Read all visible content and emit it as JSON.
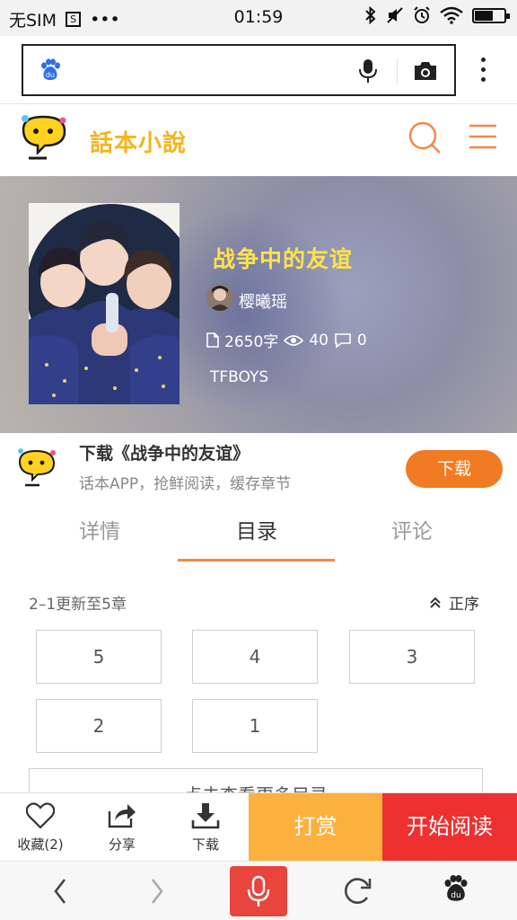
{
  "status_bar": {
    "carrier": "无SIM",
    "sim_badge": "S",
    "dots": "•••",
    "time": "01:59"
  },
  "browser": {
    "search_placeholder": "",
    "logo_icon": "baidu-paw-icon"
  },
  "site": {
    "logo_text": "話本小說"
  },
  "book": {
    "title": "战争中的友谊",
    "author": "樱曦瑶",
    "word_count": "2650字",
    "views": "40",
    "comments": "0",
    "tag": "TFBOYS"
  },
  "download_banner": {
    "title": "下载《战争中的友谊》",
    "subtitle": "话本APP，抢鲜阅读，缓存章节",
    "button": "下载"
  },
  "tabs": [
    {
      "label": "详情",
      "active": false
    },
    {
      "label": "目录",
      "active": true
    },
    {
      "label": "评论",
      "active": false
    }
  ],
  "catalog": {
    "update_info": "2–1更新至5章",
    "sort_label": "正序",
    "chapters": [
      "5",
      "4",
      "3",
      "2",
      "1"
    ],
    "more_label": "点击查看更多目录"
  },
  "action_bar": {
    "favorite": "收藏(2)",
    "share": "分享",
    "download": "下载",
    "reward": "打赏",
    "start_reading": "开始阅读"
  },
  "colors": {
    "brand_orange": "#f07b22",
    "reward_yellow": "#fcb03d",
    "read_red": "#ee3130",
    "title_yellow": "#ffe24a",
    "tab_underline": "#f2894a"
  }
}
